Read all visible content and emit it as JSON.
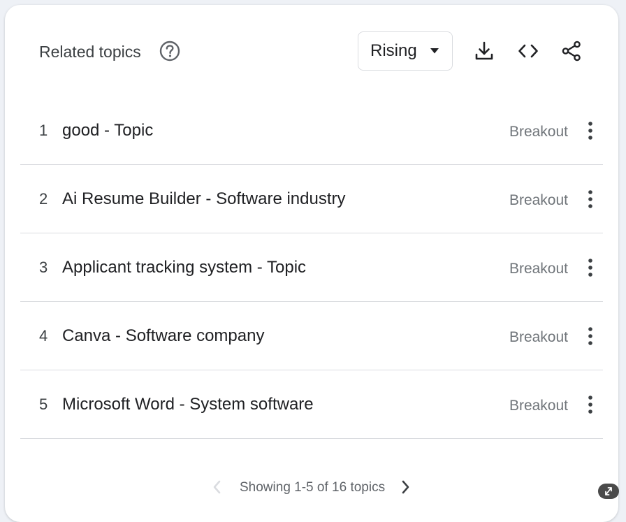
{
  "header": {
    "title": "Related topics",
    "dropdown_value": "Rising"
  },
  "icons": {
    "help": "help-circle-icon",
    "caret": "caret-down-icon",
    "download": "download-icon",
    "embed": "code-embed-icon",
    "share": "share-icon",
    "menu": "more-vert-icon"
  },
  "rows": [
    {
      "rank": "1",
      "text": "good - Topic",
      "value": "Breakout"
    },
    {
      "rank": "2",
      "text": "Ai Resume Builder - Software industry",
      "value": "Breakout"
    },
    {
      "rank": "3",
      "text": "Applicant tracking system - Topic",
      "value": "Breakout"
    },
    {
      "rank": "4",
      "text": "Canva - Software company",
      "value": "Breakout"
    },
    {
      "rank": "5",
      "text": "Microsoft Word - System software",
      "value": "Breakout"
    }
  ],
  "pager": {
    "text": "Showing 1-5 of 16 topics"
  },
  "colors": {
    "text_primary": "#202124",
    "text_secondary": "#70757a",
    "divider": "#dadce0",
    "icon": "#3c4043"
  }
}
